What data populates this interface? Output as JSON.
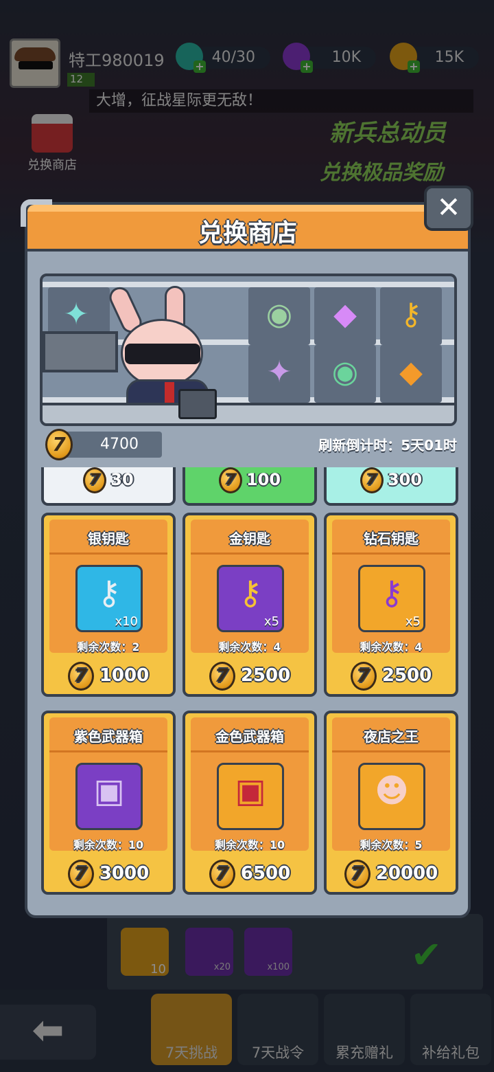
{
  "player": {
    "name": "特工980019",
    "level": "12"
  },
  "resources": [
    {
      "icon": "battery-icon",
      "value": "40/30"
    },
    {
      "icon": "gem-icon",
      "value": "10K"
    },
    {
      "icon": "coin-icon",
      "value": "15K"
    }
  ],
  "marquee": "大增，征战星际更无敌！",
  "bg_store_label": "兑换商店",
  "banner": {
    "line1": "新兵总动员",
    "line2": "兑换极品奖励"
  },
  "dialog": {
    "title": "兑换商店",
    "balance": "4700",
    "countdown": "刷新倒计时：5天01时"
  },
  "top_partial_prices": [
    "30",
    "100",
    "300"
  ],
  "cards": [
    {
      "name": "银钥匙",
      "qty": "x10",
      "remain": "剩余次数：2",
      "price": "1000",
      "icon": "silver-key-icon",
      "bg": "#2fb7e6"
    },
    {
      "name": "金钥匙",
      "qty": "x5",
      "remain": "剩余次数：4",
      "price": "2500",
      "icon": "gold-key-icon",
      "bg": "#7b3fc4"
    },
    {
      "name": "钻石钥匙",
      "qty": "x5",
      "remain": "剩余次数：4",
      "price": "2500",
      "icon": "diamond-key-icon",
      "bg": "#f2a62a"
    },
    {
      "name": "紫色武器箱",
      "qty": "",
      "remain": "剩余次数：10",
      "price": "3000",
      "icon": "purple-chest-icon",
      "bg": "#7b3fc4"
    },
    {
      "name": "金色武器箱",
      "qty": "",
      "remain": "剩余次数：10",
      "price": "6500",
      "icon": "gold-chest-icon",
      "bg": "#f2a62a"
    },
    {
      "name": "夜店之王",
      "qty": "",
      "remain": "剩余次数：5",
      "price": "20000",
      "icon": "rabbit-avatar-icon",
      "bg": "#f2a62a"
    }
  ],
  "bottom_rewards": [
    {
      "icon": "coin-stack-icon",
      "qty": "10"
    },
    {
      "icon": "gem-icon",
      "qty": "x20"
    },
    {
      "icon": "coin-icon",
      "qty": "x100"
    }
  ],
  "nav": [
    "7天挑战",
    "7天战令",
    "累充赠礼",
    "补给礼包"
  ],
  "coin_symbol": "7"
}
